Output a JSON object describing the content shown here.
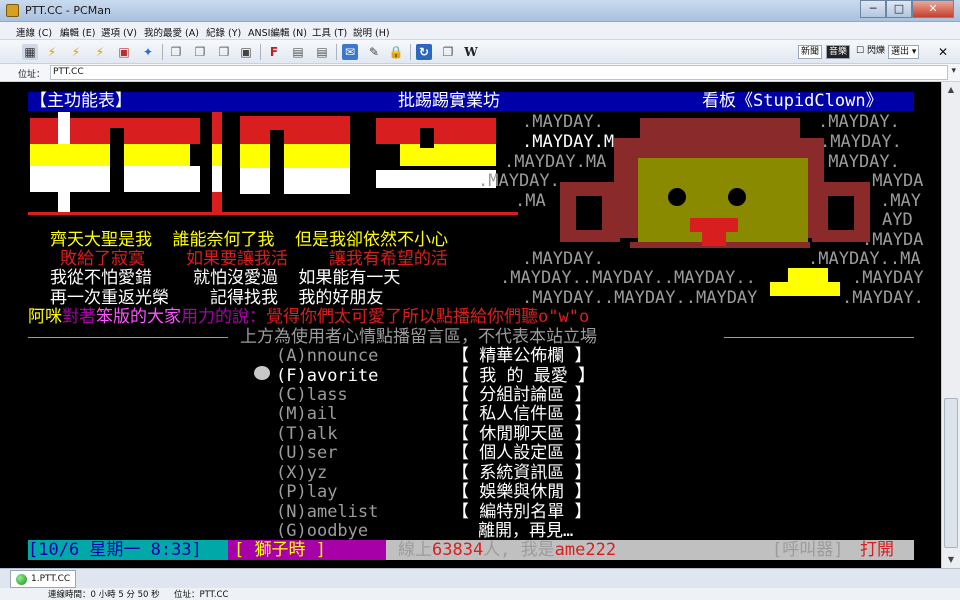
{
  "window": {
    "title": "PTT.CC - PCMan",
    "min": "─",
    "max": "□",
    "close": "✕"
  },
  "menu": [
    "連線 (C)",
    "編輯 (E)",
    "選項 (V)",
    "我的最愛 (A)",
    "紀錄 (Y)",
    "ANSI編輯 (N)",
    "工具 (T)",
    "說明 (H)"
  ],
  "toolbar": {
    "new_label": "新聞",
    "sound_label": "音樂",
    "check_label": "閃爍",
    "drop_label": "選出"
  },
  "address": {
    "label": "位址：",
    "value": "PTT.CC"
  },
  "terminal": {
    "header": {
      "left": "【主功能表】",
      "center": "批踢踢實業坊",
      "right": "看板《StupidClown》"
    },
    "mayday_lines": [
      ".MAYDAY.",
      ".MAYDAY.M",
      ".MAYDAY.MA",
      ".MAYDAY.",
      ".MA",
      ".MAYDAY.",
      ".MAYDAY.",
      ".MAYDAY.",
      ".MAYDA",
      ".MAY",
      "AYD",
      ".MAYDA",
      ".MAYDAY.",
      ".MAYDAY..MA",
      ".MAYDAY..MAYDAY..MAYDAY..",
      ".MAYDAY",
      ".MAYDAY..MAYDAY..MAYDAY",
      ".MAYDAY."
    ],
    "lyrics": [
      "齊天大聖是我  誰能奈何了我  但是我卻依然不小心",
      "敗給了寂寞    如果要讓我活    讓我有希望的活",
      "我從不怕愛錯    就怕沒愛過  如果能有一天",
      "再一次重返光榮    記得找我  我的好朋友"
    ],
    "signature": {
      "p1": "阿咪",
      "p2": "對著",
      "p3": "笨版的大家",
      "p4": "用力的說：",
      "p5": "覺得你們太可愛了所以點播給你們聽o\"w\"o"
    },
    "notice": "上方為使用者心情點播留言區，不代表本站立場",
    "menu_items": [
      {
        "key": "(A)",
        "name": "nnounce",
        "desc": "【 精華公佈欄 】"
      },
      {
        "key": "(F)",
        "name": "avorite",
        "desc": "【 我 的 最愛 】"
      },
      {
        "key": "(C)",
        "name": "lass",
        "desc": "【 分組討論區 】"
      },
      {
        "key": "(M)",
        "name": "ail",
        "desc": "【 私人信件區 】"
      },
      {
        "key": "(T)",
        "name": "alk",
        "desc": "【 休閒聊天區 】"
      },
      {
        "key": "(U)",
        "name": "ser",
        "desc": "【 個人設定區 】"
      },
      {
        "key": "(X)",
        "name": "yz",
        "desc": "【 系統資訊區 】"
      },
      {
        "key": "(P)",
        "name": "lay",
        "desc": "【 娛樂與休閒 】"
      },
      {
        "key": "(N)",
        "name": "amelist",
        "desc": "【 編特別名單 】"
      },
      {
        "key": "(G)",
        "name": "oodbye",
        "desc": "離開，再見…"
      }
    ],
    "selected_index": 1,
    "status": {
      "date": "[10/6 星期一 8:33]",
      "zodiac": "[ 獅子時 ]",
      "online_prefix": "線上",
      "online_count": "63834",
      "online_suffix": "人, 我是",
      "user": "ame222",
      "call_label": "[呼叫器]",
      "call_state": "打開"
    }
  },
  "tab": {
    "label": "1.PTT.CC"
  },
  "statusbar": {
    "connect_time": "連線時間：0 小時 5 分 50 秒",
    "address": "位址：PTT.CC"
  },
  "colors": {
    "red": "#d81e1e",
    "yellow": "#ffff00",
    "white": "#ffffff",
    "grey": "#9c9c9c",
    "blue": "#0000a8",
    "cyan": "#00a8a8",
    "magenta": "#a800a8",
    "monkey_brown": "#8a2a2a",
    "monkey_olive": "#8a8a00"
  }
}
